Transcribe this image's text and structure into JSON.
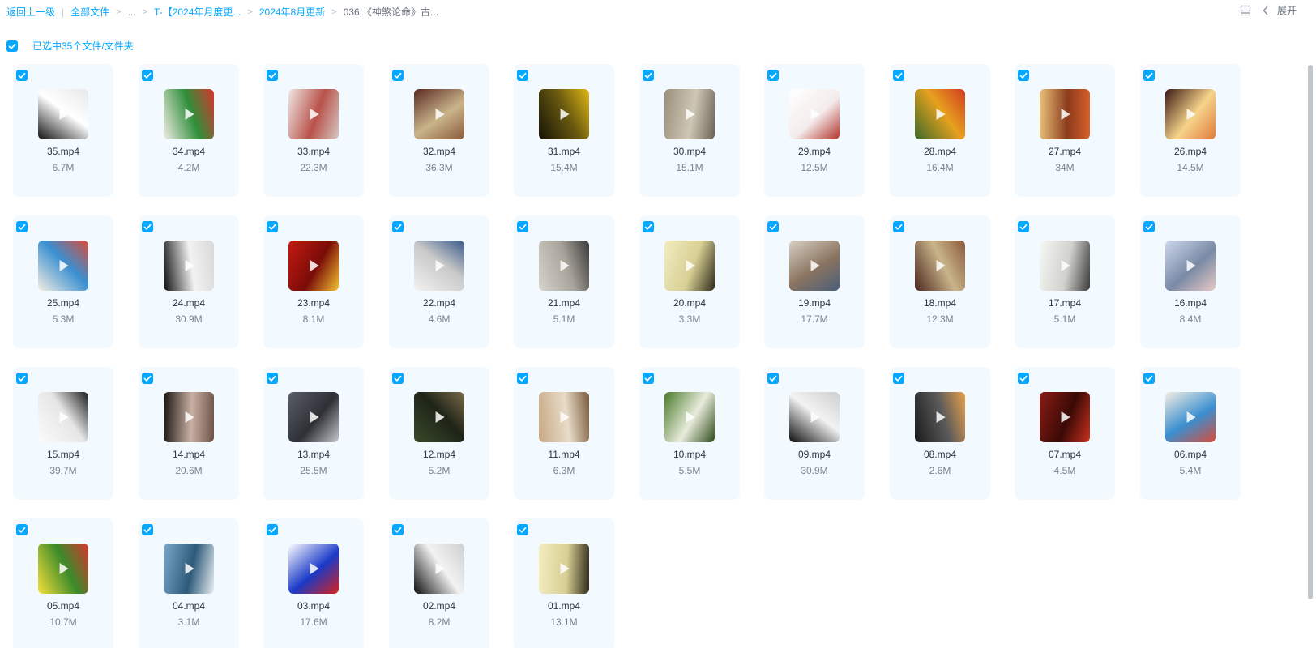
{
  "breadcrumb": {
    "back": "返回上一级",
    "all_files": "全部文件",
    "ellipsis": "...",
    "folder1": "T-【2024年月度更...",
    "folder2": "2024年8月更新",
    "current": "036.《神煞论命》古..."
  },
  "toolbar": {
    "list_view_icon": "list-view-icon",
    "expand_label": "展开"
  },
  "selection": {
    "label": "已选中35个文件/文件夹",
    "all_checked": true
  },
  "colors": {
    "accent": "#06a7ff",
    "card_bg": "#f2f9ff"
  },
  "files": [
    {
      "name": "35.mp4",
      "size": "6.7M",
      "colors": [
        "#111111",
        "#e8e8e8",
        "#ffffff"
      ]
    },
    {
      "name": "34.mp4",
      "size": "4.2M",
      "colors": [
        "#f0ece4",
        "#d8342c",
        "#2f8f3a"
      ]
    },
    {
      "name": "33.mp4",
      "size": "22.3M",
      "colors": [
        "#efe6e4",
        "#d6c7c4",
        "#b9524a"
      ]
    },
    {
      "name": "32.mp4",
      "size": "36.3M",
      "colors": [
        "#5a2a22",
        "#8b5a3c",
        "#c9b48a"
      ]
    },
    {
      "name": "31.mp4",
      "size": "15.4M",
      "colors": [
        "#141206",
        "#e0b713",
        "#6a5a10"
      ]
    },
    {
      "name": "30.mp4",
      "size": "15.1M",
      "colors": [
        "#9a8f7c",
        "#6b6255",
        "#cfc7b5"
      ]
    },
    {
      "name": "29.mp4",
      "size": "12.5M",
      "colors": [
        "#ffffff",
        "#b3332b",
        "#f4ecec"
      ]
    },
    {
      "name": "28.mp4",
      "size": "16.4M",
      "colors": [
        "#3b6a2a",
        "#d23a1e",
        "#e6a11e"
      ]
    },
    {
      "name": "27.mp4",
      "size": "34M",
      "colors": [
        "#e9c27a",
        "#d8602a",
        "#8c3b1c"
      ]
    },
    {
      "name": "26.mp4",
      "size": "14.5M",
      "colors": [
        "#3a1a14",
        "#e07b3a",
        "#f6d38a"
      ]
    },
    {
      "name": "25.mp4",
      "size": "5.3M",
      "colors": [
        "#f5efe4",
        "#d84c3a",
        "#3a8fd0"
      ]
    },
    {
      "name": "24.mp4",
      "size": "30.9M",
      "colors": [
        "#0d0d0d",
        "#d8d8d8",
        "#f2f2f2"
      ]
    },
    {
      "name": "23.mp4",
      "size": "8.1M",
      "colors": [
        "#c41a12",
        "#f2c230",
        "#7a0c08"
      ]
    },
    {
      "name": "22.mp4",
      "size": "4.6M",
      "colors": [
        "#f2f2f2",
        "#3a5a8a",
        "#c9c9c9"
      ]
    },
    {
      "name": "21.mp4",
      "size": "5.1M",
      "colors": [
        "#d6d3cc",
        "#3a3a3a",
        "#a8a39a"
      ]
    },
    {
      "name": "20.mp4",
      "size": "3.3M",
      "colors": [
        "#f3ecc0",
        "#2e2a1a",
        "#d8cf94"
      ]
    },
    {
      "name": "19.mp4",
      "size": "17.7M",
      "colors": [
        "#d8d0c4",
        "#4a5e7a",
        "#8a7460"
      ]
    },
    {
      "name": "18.mp4",
      "size": "12.3M",
      "colors": [
        "#4a261e",
        "#8a5a3c",
        "#c9b48a"
      ]
    },
    {
      "name": "17.mp4",
      "size": "5.1M",
      "colors": [
        "#f7f7f5",
        "#3a3a3a",
        "#d0d0cc"
      ]
    },
    {
      "name": "16.mp4",
      "size": "8.4M",
      "colors": [
        "#cdd8ec",
        "#e8c9c4",
        "#7a8aa6"
      ]
    },
    {
      "name": "15.mp4",
      "size": "39.7M",
      "colors": [
        "#fbfbfb",
        "#1a1a1a",
        "#e6e6e6"
      ]
    },
    {
      "name": "14.mp4",
      "size": "20.6M",
      "colors": [
        "#1a1412",
        "#6e5248",
        "#c9b0a4"
      ]
    },
    {
      "name": "13.mp4",
      "size": "25.5M",
      "colors": [
        "#5a5e66",
        "#c6c8cc",
        "#2e3036"
      ]
    },
    {
      "name": "12.mp4",
      "size": "5.2M",
      "colors": [
        "#3a4a2a",
        "#7a6a4a",
        "#1e2418"
      ]
    },
    {
      "name": "11.mp4",
      "size": "6.3M",
      "colors": [
        "#c7a884",
        "#7a5a3c",
        "#e8dcc8"
      ]
    },
    {
      "name": "10.mp4",
      "size": "5.5M",
      "colors": [
        "#4a7a2a",
        "#2e4a1a",
        "#e8ecdc"
      ]
    },
    {
      "name": "09.mp4",
      "size": "30.9M",
      "colors": [
        "#0d0d0d",
        "#cfcfcf",
        "#f2f2f2"
      ]
    },
    {
      "name": "08.mp4",
      "size": "2.6M",
      "colors": [
        "#1a1a1a",
        "#e8a04a",
        "#5a5a5a"
      ]
    },
    {
      "name": "07.mp4",
      "size": "4.5M",
      "colors": [
        "#8a1c14",
        "#c9301e",
        "#3a0a06"
      ]
    },
    {
      "name": "06.mp4",
      "size": "5.4M",
      "colors": [
        "#f5efe4",
        "#d84c3a",
        "#3a8fd0"
      ]
    },
    {
      "name": "05.mp4",
      "size": "10.7M",
      "colors": [
        "#f6e03a",
        "#d8342c",
        "#3a8a2a"
      ]
    },
    {
      "name": "04.mp4",
      "size": "3.1M",
      "colors": [
        "#7aa6c8",
        "#e8eef2",
        "#2e5a7a"
      ]
    },
    {
      "name": "03.mp4",
      "size": "17.6M",
      "colors": [
        "#ffffff",
        "#d8201c",
        "#1a3ac8"
      ]
    },
    {
      "name": "02.mp4",
      "size": "8.2M",
      "colors": [
        "#0d0d0d",
        "#cfcfcf",
        "#f2f2f2"
      ]
    },
    {
      "name": "01.mp4",
      "size": "13.1M",
      "colors": [
        "#f3ecc0",
        "#2e2a1a",
        "#d8cf94"
      ]
    }
  ]
}
